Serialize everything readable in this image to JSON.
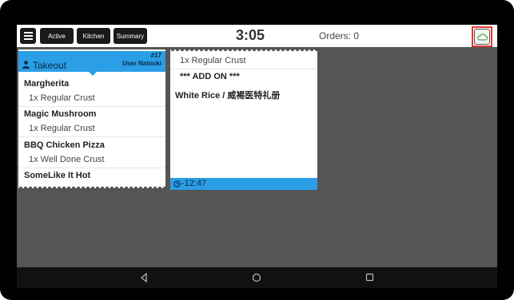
{
  "topbar": {
    "buttons": [
      "Active",
      "Kitchen",
      "Summary"
    ],
    "clock": "3:05",
    "orders": "Orders: 0"
  },
  "card1": {
    "order_number": "#17",
    "type": "Takeout",
    "user": "User Natsuki",
    "items": [
      {
        "name": "Margherita",
        "mod": "1x Regular Crust"
      },
      {
        "name": "Magic Mushroom",
        "mod": "1x Regular Crust"
      },
      {
        "name": "BBQ Chicken Pizza",
        "mod": "1x Well Done Crust"
      },
      {
        "name": "SomeLike It Hot"
      }
    ]
  },
  "card2": {
    "lines": [
      "1x Regular Crust",
      "*** ADD ON ***",
      "White Rice / 威裼医特礼册"
    ],
    "time": "-12:47"
  },
  "colors": {
    "accent": "#2a9ee6",
    "highlight": "#e53935",
    "background": "#555555"
  }
}
